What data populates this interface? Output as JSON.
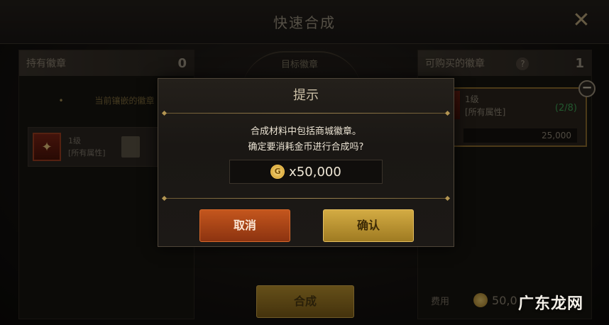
{
  "header": {
    "title": "快速合成",
    "close_icon": "close-icon"
  },
  "left_panel": {
    "title": "持有徽章",
    "count": "0",
    "current_label": "当前镶嵌的徽章",
    "badge": {
      "level": "1级",
      "attr": "[所有属性]"
    }
  },
  "middle": {
    "target_label": "目标徽章",
    "compose_button": "合成"
  },
  "right_panel": {
    "title": "可购买的徽章",
    "count": "1",
    "item": {
      "level": "1级",
      "attr": "[所有属性]",
      "fraction": "(2/8)",
      "price": "25,000"
    },
    "fee_label": "费用",
    "fee_amount": "50,0"
  },
  "modal": {
    "title": "提示",
    "line1": "合成材料中包括商城徽章。",
    "line2": "确定要消耗金币进行合成吗?",
    "coin_glyph": "G",
    "cost": "x50,000",
    "cancel_label": "取消",
    "confirm_label": "确认"
  },
  "watermark": "广东龙网",
  "colors": {
    "accent_gold": "#d3ab43",
    "cancel_orange": "#c4561d",
    "green": "#3ea155"
  }
}
